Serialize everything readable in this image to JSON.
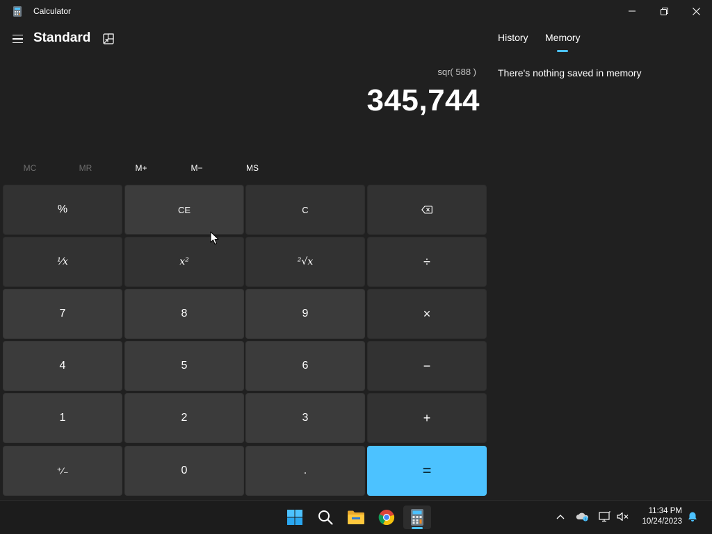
{
  "window": {
    "title": "Calculator",
    "minimize_glyph": "—",
    "maximize_glyph": "❐",
    "close_glyph": "✕"
  },
  "header": {
    "mode_title": "Standard",
    "menu_icon": "hamburger-icon",
    "keep_on_top_icon": "keep-on-top-icon"
  },
  "display": {
    "expression": "sqr( 588 )",
    "result": "345,744"
  },
  "memory_buttons": [
    {
      "label": "MC",
      "enabled": false
    },
    {
      "label": "MR",
      "enabled": false
    },
    {
      "label": "M+",
      "enabled": true
    },
    {
      "label": "M−",
      "enabled": true
    },
    {
      "label": "MS",
      "enabled": true
    }
  ],
  "keypad": {
    "percent": "%",
    "clear_entry": "CE",
    "clear": "C",
    "backspace_icon": "backspace-icon",
    "reciprocal": "¹⁄x",
    "square": "x²",
    "square_root": "²√x",
    "divide": "÷",
    "seven": "7",
    "eight": "8",
    "nine": "9",
    "multiply": "×",
    "four": "4",
    "five": "5",
    "six": "6",
    "subtract": "−",
    "one": "1",
    "two": "2",
    "three": "3",
    "add": "+",
    "negate": "⁺⁄₋",
    "zero": "0",
    "decimal": ".",
    "equals": "="
  },
  "side_panel": {
    "tabs": [
      {
        "label": "History",
        "selected": false
      },
      {
        "label": "Memory",
        "selected": true
      }
    ],
    "empty_message": "There's nothing saved in memory"
  },
  "taskbar": {
    "apps": [
      "windows-start-icon",
      "search-icon",
      "file-explorer-icon",
      "chrome-icon",
      "calculator-icon"
    ],
    "active_app": "calculator-icon",
    "tray": [
      "show-hidden-icons-chevron",
      "onedrive-icon",
      "network-icon",
      "volume-muted-icon",
      "notifications-bell-icon"
    ],
    "time": "11:34 PM",
    "date": "10/24/2023"
  },
  "colors": {
    "background": "#202020",
    "accent": "#4cc2ff",
    "function_key": "#323232",
    "number_key": "#3b3b3b",
    "taskbar": "#1c1c1c"
  }
}
